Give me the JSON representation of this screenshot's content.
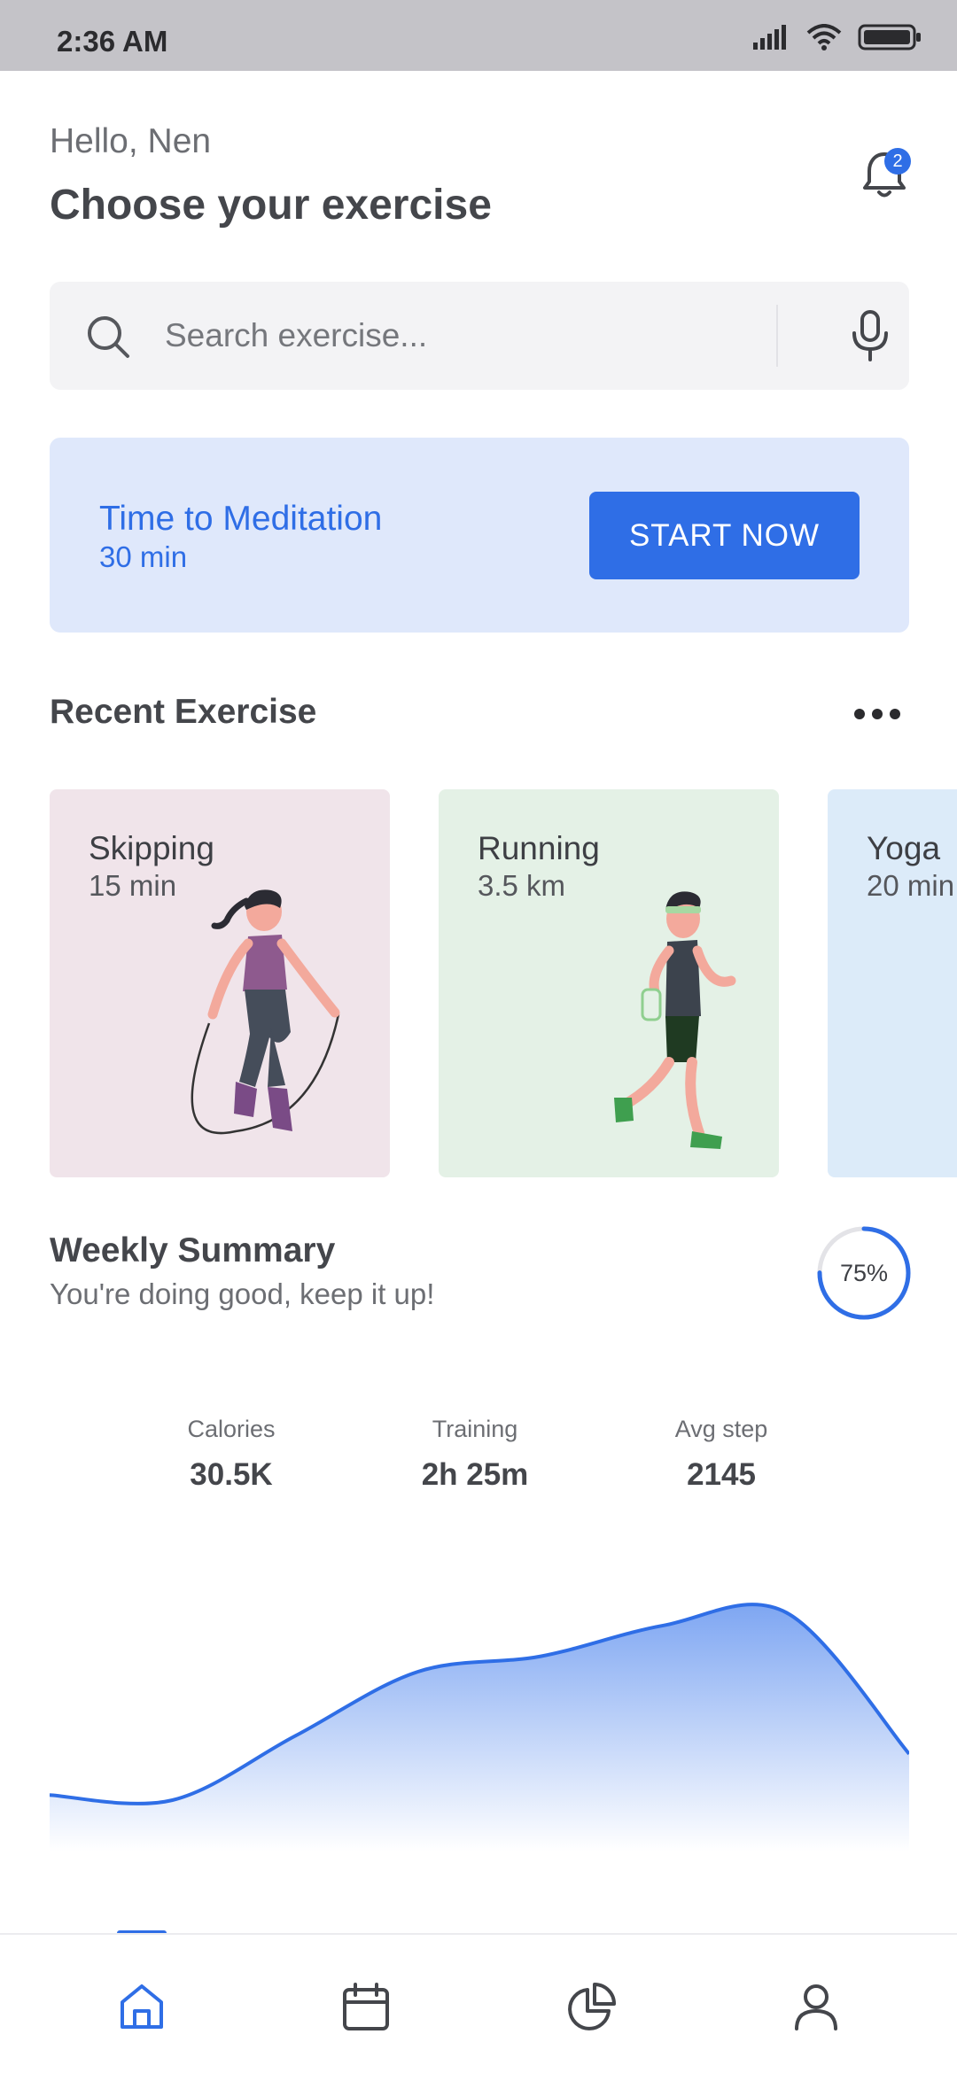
{
  "status_bar": {
    "time": "2:36 AM"
  },
  "header": {
    "greeting": "Hello, Nen",
    "title": "Choose your exercise",
    "notification_count": "2"
  },
  "search": {
    "placeholder": "Search exercise..."
  },
  "banner": {
    "title": "Time to Meditation",
    "subtitle": "30 min",
    "button_label": "START NOW"
  },
  "recent": {
    "title": "Recent Exercise",
    "cards": [
      {
        "title": "Skipping",
        "subtitle": "15 min",
        "bg": "#f0e4ea"
      },
      {
        "title": "Running",
        "subtitle": "3.5 km",
        "bg": "#e4f1e6"
      },
      {
        "title": "Yoga",
        "subtitle": "20 min",
        "bg": "#dcebf9"
      }
    ]
  },
  "weekly": {
    "title": "Weekly Summary",
    "subtitle": "You're doing good, keep it up!",
    "progress_label": "75%",
    "progress_value": 0.75,
    "stats": [
      {
        "label": "Calories",
        "value": "30.5K"
      },
      {
        "label": "Training",
        "value": "2h 25m"
      },
      {
        "label": "Avg step",
        "value": "2145"
      }
    ]
  },
  "chart_data": {
    "type": "area",
    "values": [
      0.22,
      0.2,
      0.45,
      0.7,
      0.76,
      0.88,
      0.93,
      0.38
    ],
    "ylim": [
      0,
      1
    ],
    "grid": false,
    "title": "",
    "xlabel": "",
    "ylabel": ""
  },
  "nav": {
    "items": [
      "home-icon",
      "calendar-icon",
      "pie-chart-icon",
      "profile-icon"
    ],
    "active_index": 0
  },
  "colors": {
    "accent": "#2f6ee6",
    "banner_bg": "#dfe8fb",
    "search_bg": "#f3f3f5",
    "text": "#3d3f44"
  }
}
